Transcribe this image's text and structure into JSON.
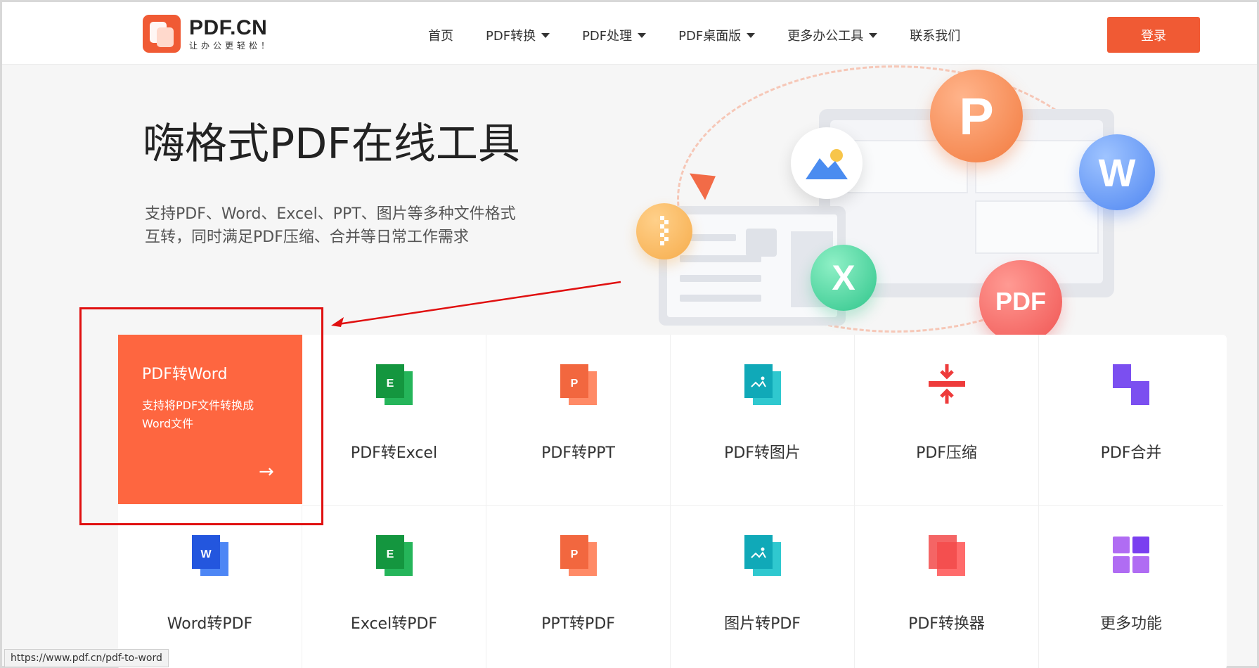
{
  "header": {
    "logo_title": "PDF.CN",
    "logo_sub": "让办公更轻松！",
    "nav": [
      {
        "label": "首页",
        "dropdown": false
      },
      {
        "label": "PDF转换",
        "dropdown": true
      },
      {
        "label": "PDF处理",
        "dropdown": true
      },
      {
        "label": "PDF桌面版",
        "dropdown": true
      },
      {
        "label": "更多办公工具",
        "dropdown": true
      },
      {
        "label": "联系我们",
        "dropdown": false
      }
    ],
    "login_label": "登录"
  },
  "hero": {
    "title": "嗨格式PDF在线工具",
    "desc_line1": "支持PDF、Word、Excel、PPT、图片等多种文件格式",
    "desc_line2": "互转，同时满足PDF压缩、合并等日常工作需求"
  },
  "illustration": {
    "bubble_p": "P",
    "bubble_w": "W",
    "bubble_x": "X",
    "bubble_pdf": "PDF"
  },
  "featured_tool": {
    "title": "PDF转Word",
    "desc": "支持将PDF文件转换成Word文件",
    "arrow": "→"
  },
  "tools": [
    {
      "label": "PDF转Excel",
      "icon": "excel-icon",
      "color": "#1aa34a"
    },
    {
      "label": "PDF转PPT",
      "icon": "ppt-icon",
      "color": "#f05a34"
    },
    {
      "label": "PDF转图片",
      "icon": "image-icon",
      "color": "#13b3c0"
    },
    {
      "label": "PDF压缩",
      "icon": "compress-icon",
      "color": "#ee3b3b"
    },
    {
      "label": "PDF合并",
      "icon": "merge-icon",
      "color": "#7b4ff0"
    },
    {
      "label": "Word转PDF",
      "icon": "word-icon",
      "color": "#2a62e8"
    },
    {
      "label": "Excel转PDF",
      "icon": "excel-icon",
      "color": "#1aa34a"
    },
    {
      "label": "PPT转PDF",
      "icon": "ppt-icon",
      "color": "#f05a34"
    },
    {
      "label": "图片转PDF",
      "icon": "image-icon",
      "color": "#13b3c0"
    },
    {
      "label": "PDF转换器",
      "icon": "converter-icon",
      "color": "#ee3b3b"
    },
    {
      "label": "更多功能",
      "icon": "grid-icon",
      "color": "#9a5cf0"
    }
  ],
  "status_bar": {
    "url": "https://www.pdf.cn/pdf-to-word"
  }
}
